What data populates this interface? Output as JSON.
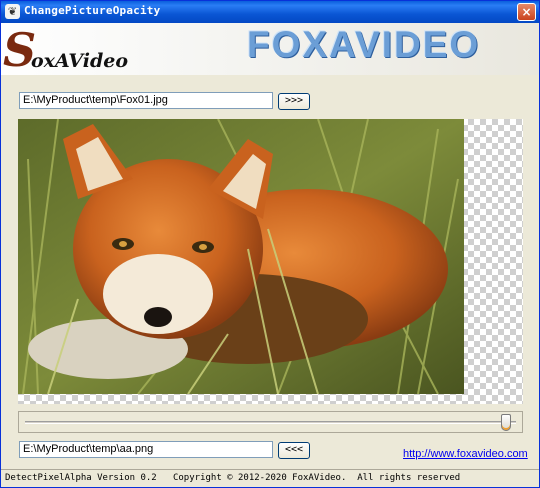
{
  "window": {
    "title": "ChangePictureOpacity",
    "close_label": "×"
  },
  "banner": {
    "logo_initial": "S",
    "logo_rest": "oxAVideo",
    "brand": "FOXAVIDEO"
  },
  "source": {
    "path": "E:\\MyProduct\\temp\\Fox01.jpg",
    "button_label": ">>>"
  },
  "opacity_slider": {
    "value_fraction": 0.99
  },
  "output": {
    "path": "E:\\MyProduct\\temp\\aa.png",
    "button_label": "<<<"
  },
  "link": {
    "text": "http://www.foxavideo.com"
  },
  "status": {
    "text": "DetectPixelAlpha Version 0.2   Copyright © 2012-2020 FoxAVideo.  All rights reserved"
  },
  "colors": {
    "accent": "#0a56d4",
    "brand": "#6b9ed6"
  }
}
